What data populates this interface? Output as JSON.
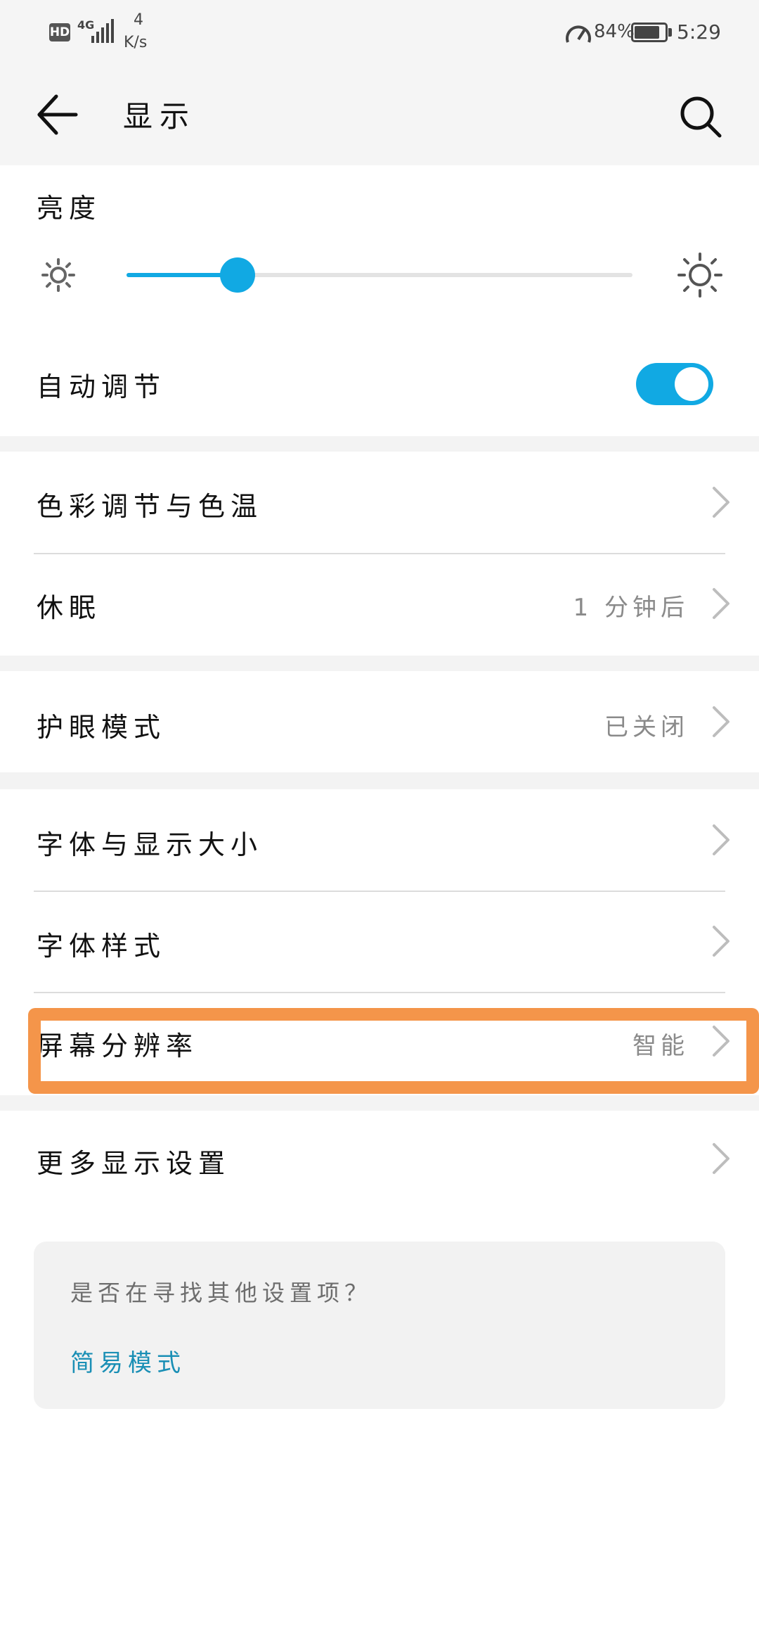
{
  "status_bar": {
    "hd": "HD",
    "network": "4G",
    "speed_value": "4",
    "speed_unit": "K/s",
    "battery_percent": "84%",
    "battery_level": 0.84,
    "time": "5:29"
  },
  "app_bar": {
    "title": "显示"
  },
  "brightness": {
    "label": "亮度",
    "level": 0.22
  },
  "auto_adjust": {
    "label": "自动调节",
    "enabled": true
  },
  "items": {
    "color_temp": {
      "label": "色彩调节与色温"
    },
    "sleep": {
      "label": "休眠",
      "value": "1 分钟后"
    },
    "eye_comfort": {
      "label": "护眼模式",
      "value": "已关闭"
    },
    "font_size": {
      "label": "字体与显示大小"
    },
    "font_style": {
      "label": "字体样式"
    },
    "resolution": {
      "label": "屏幕分辨率",
      "value": "智能"
    },
    "more_display": {
      "label": "更多显示设置"
    }
  },
  "help": {
    "question": "是否在寻找其他设置项？",
    "link": "简易模式"
  },
  "colors": {
    "accent": "#11a9e3",
    "highlight": "#f4954a",
    "link": "#1a8fb5"
  }
}
